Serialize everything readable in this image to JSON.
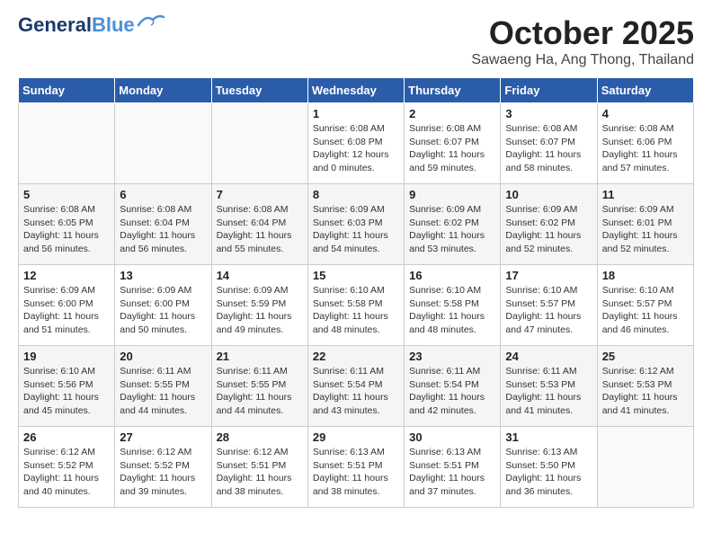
{
  "logo": {
    "line1": "General",
    "line2": "Blue"
  },
  "title": "October 2025",
  "subtitle": "Sawaeng Ha, Ang Thong, Thailand",
  "days_header": [
    "Sunday",
    "Monday",
    "Tuesday",
    "Wednesday",
    "Thursday",
    "Friday",
    "Saturday"
  ],
  "weeks": [
    [
      {
        "day": "",
        "info": ""
      },
      {
        "day": "",
        "info": ""
      },
      {
        "day": "",
        "info": ""
      },
      {
        "day": "1",
        "info": "Sunrise: 6:08 AM\nSunset: 6:08 PM\nDaylight: 12 hours\nand 0 minutes."
      },
      {
        "day": "2",
        "info": "Sunrise: 6:08 AM\nSunset: 6:07 PM\nDaylight: 11 hours\nand 59 minutes."
      },
      {
        "day": "3",
        "info": "Sunrise: 6:08 AM\nSunset: 6:07 PM\nDaylight: 11 hours\nand 58 minutes."
      },
      {
        "day": "4",
        "info": "Sunrise: 6:08 AM\nSunset: 6:06 PM\nDaylight: 11 hours\nand 57 minutes."
      }
    ],
    [
      {
        "day": "5",
        "info": "Sunrise: 6:08 AM\nSunset: 6:05 PM\nDaylight: 11 hours\nand 56 minutes."
      },
      {
        "day": "6",
        "info": "Sunrise: 6:08 AM\nSunset: 6:04 PM\nDaylight: 11 hours\nand 56 minutes."
      },
      {
        "day": "7",
        "info": "Sunrise: 6:08 AM\nSunset: 6:04 PM\nDaylight: 11 hours\nand 55 minutes."
      },
      {
        "day": "8",
        "info": "Sunrise: 6:09 AM\nSunset: 6:03 PM\nDaylight: 11 hours\nand 54 minutes."
      },
      {
        "day": "9",
        "info": "Sunrise: 6:09 AM\nSunset: 6:02 PM\nDaylight: 11 hours\nand 53 minutes."
      },
      {
        "day": "10",
        "info": "Sunrise: 6:09 AM\nSunset: 6:02 PM\nDaylight: 11 hours\nand 52 minutes."
      },
      {
        "day": "11",
        "info": "Sunrise: 6:09 AM\nSunset: 6:01 PM\nDaylight: 11 hours\nand 52 minutes."
      }
    ],
    [
      {
        "day": "12",
        "info": "Sunrise: 6:09 AM\nSunset: 6:00 PM\nDaylight: 11 hours\nand 51 minutes."
      },
      {
        "day": "13",
        "info": "Sunrise: 6:09 AM\nSunset: 6:00 PM\nDaylight: 11 hours\nand 50 minutes."
      },
      {
        "day": "14",
        "info": "Sunrise: 6:09 AM\nSunset: 5:59 PM\nDaylight: 11 hours\nand 49 minutes."
      },
      {
        "day": "15",
        "info": "Sunrise: 6:10 AM\nSunset: 5:58 PM\nDaylight: 11 hours\nand 48 minutes."
      },
      {
        "day": "16",
        "info": "Sunrise: 6:10 AM\nSunset: 5:58 PM\nDaylight: 11 hours\nand 48 minutes."
      },
      {
        "day": "17",
        "info": "Sunrise: 6:10 AM\nSunset: 5:57 PM\nDaylight: 11 hours\nand 47 minutes."
      },
      {
        "day": "18",
        "info": "Sunrise: 6:10 AM\nSunset: 5:57 PM\nDaylight: 11 hours\nand 46 minutes."
      }
    ],
    [
      {
        "day": "19",
        "info": "Sunrise: 6:10 AM\nSunset: 5:56 PM\nDaylight: 11 hours\nand 45 minutes."
      },
      {
        "day": "20",
        "info": "Sunrise: 6:11 AM\nSunset: 5:55 PM\nDaylight: 11 hours\nand 44 minutes."
      },
      {
        "day": "21",
        "info": "Sunrise: 6:11 AM\nSunset: 5:55 PM\nDaylight: 11 hours\nand 44 minutes."
      },
      {
        "day": "22",
        "info": "Sunrise: 6:11 AM\nSunset: 5:54 PM\nDaylight: 11 hours\nand 43 minutes."
      },
      {
        "day": "23",
        "info": "Sunrise: 6:11 AM\nSunset: 5:54 PM\nDaylight: 11 hours\nand 42 minutes."
      },
      {
        "day": "24",
        "info": "Sunrise: 6:11 AM\nSunset: 5:53 PM\nDaylight: 11 hours\nand 41 minutes."
      },
      {
        "day": "25",
        "info": "Sunrise: 6:12 AM\nSunset: 5:53 PM\nDaylight: 11 hours\nand 41 minutes."
      }
    ],
    [
      {
        "day": "26",
        "info": "Sunrise: 6:12 AM\nSunset: 5:52 PM\nDaylight: 11 hours\nand 40 minutes."
      },
      {
        "day": "27",
        "info": "Sunrise: 6:12 AM\nSunset: 5:52 PM\nDaylight: 11 hours\nand 39 minutes."
      },
      {
        "day": "28",
        "info": "Sunrise: 6:12 AM\nSunset: 5:51 PM\nDaylight: 11 hours\nand 38 minutes."
      },
      {
        "day": "29",
        "info": "Sunrise: 6:13 AM\nSunset: 5:51 PM\nDaylight: 11 hours\nand 38 minutes."
      },
      {
        "day": "30",
        "info": "Sunrise: 6:13 AM\nSunset: 5:51 PM\nDaylight: 11 hours\nand 37 minutes."
      },
      {
        "day": "31",
        "info": "Sunrise: 6:13 AM\nSunset: 5:50 PM\nDaylight: 11 hours\nand 36 minutes."
      },
      {
        "day": "",
        "info": ""
      }
    ]
  ]
}
